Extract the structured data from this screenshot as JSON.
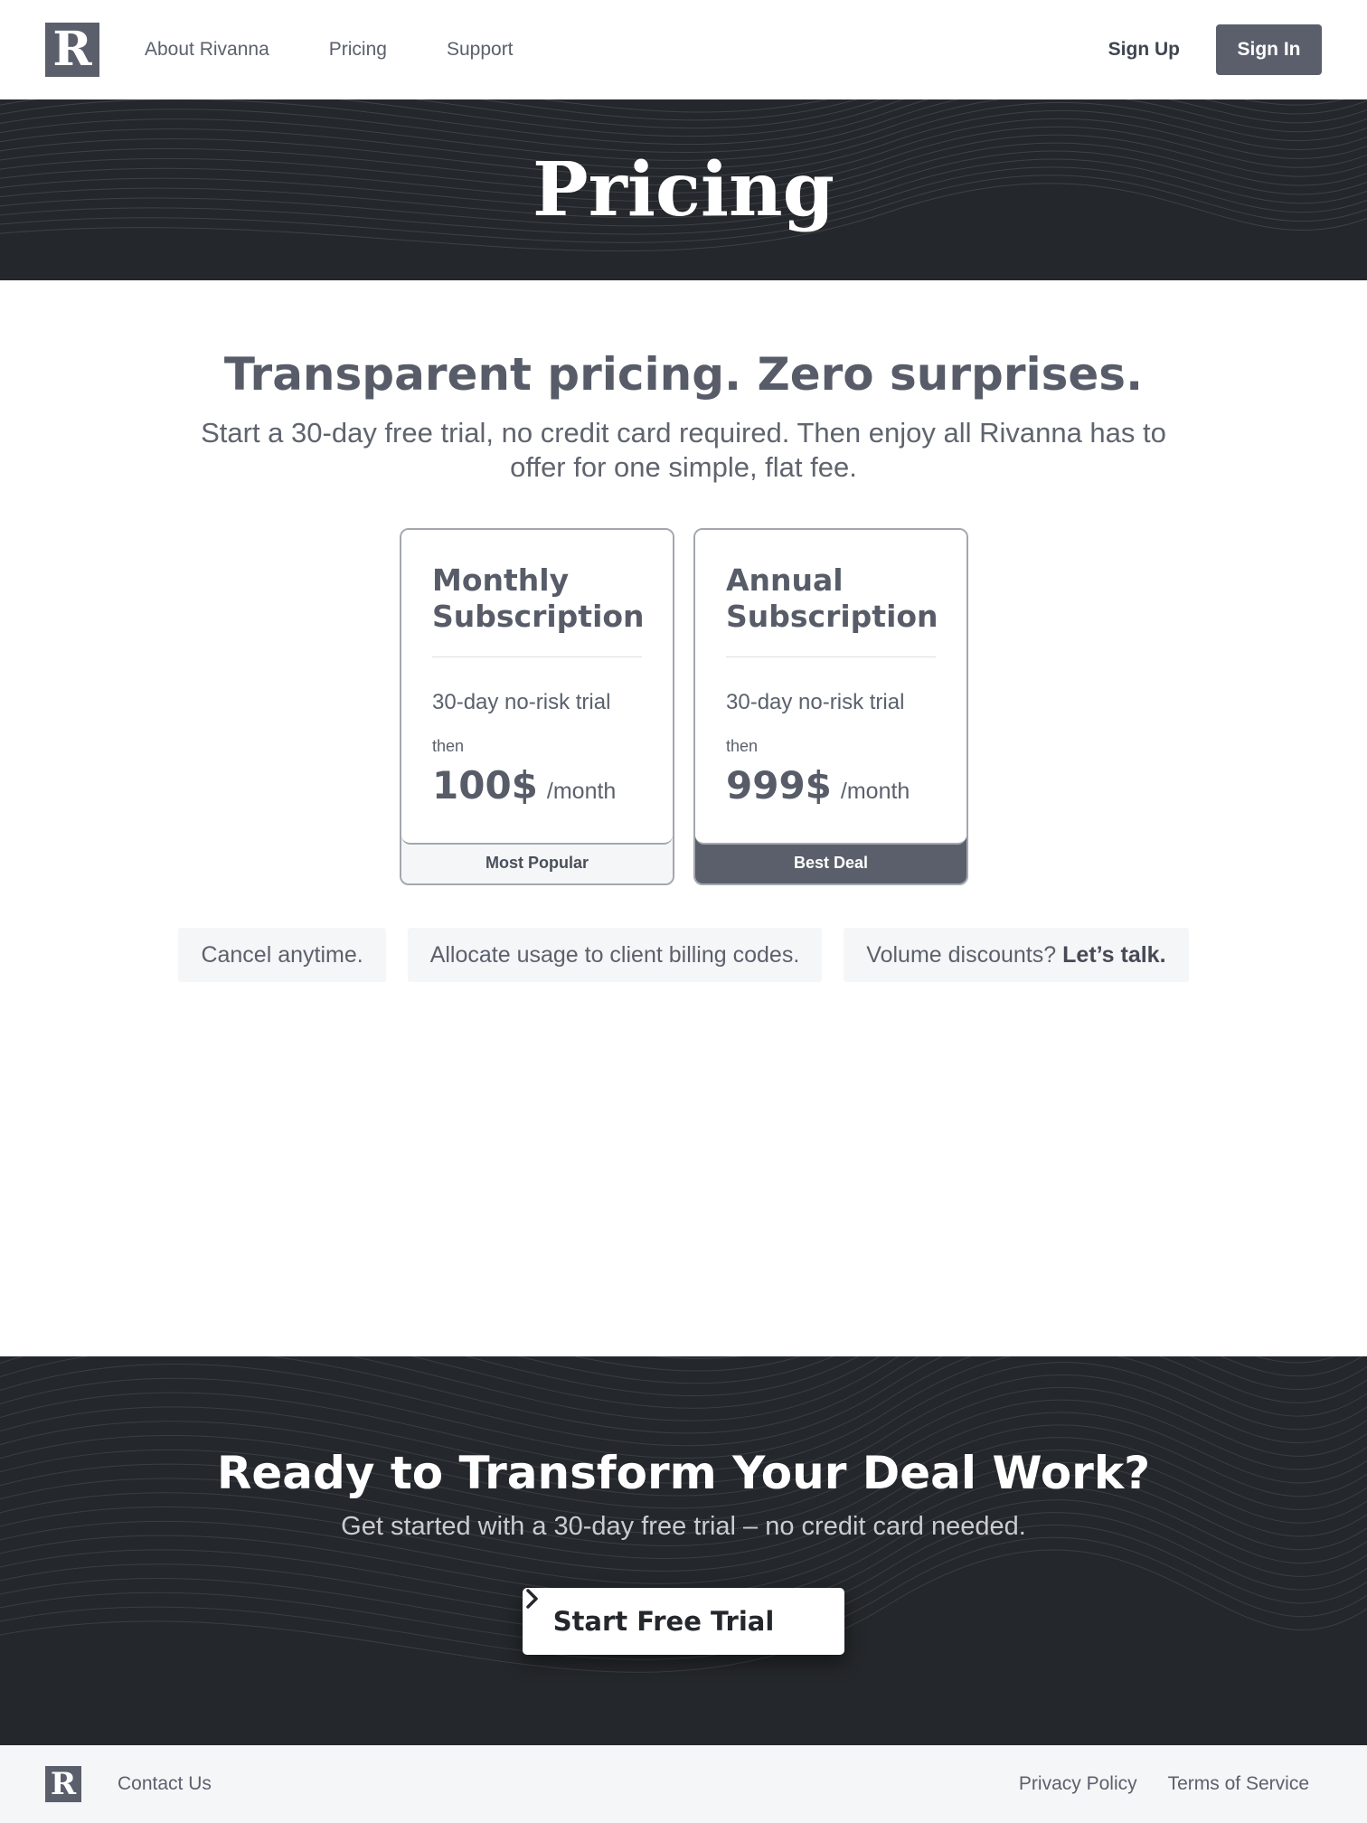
{
  "header": {
    "logo_letter": "R",
    "nav": [
      "About Rivanna",
      "Pricing",
      "Support"
    ],
    "sign_up": "Sign Up",
    "sign_in": "Sign In"
  },
  "hero": {
    "title": "Pricing"
  },
  "main": {
    "headline": "Transparent pricing. Zero surprises.",
    "subtext": "Start a 30-day free trial, no credit card required. Then enjoy all Rivanna has to offer for one simple, flat fee.",
    "plans": [
      {
        "title": "Monthly Subscription",
        "trial": "30-day no-risk trial",
        "then": "then",
        "price": "100$",
        "period": "/month",
        "badge": "Most Popular"
      },
      {
        "title": "Annual Subscription",
        "trial": "30-day no-risk trial",
        "then": "then",
        "price": "999$",
        "period": "/month",
        "badge": "Best Deal"
      }
    ],
    "chips": {
      "cancel": "Cancel anytime.",
      "allocate": "Allocate usage to client billing codes.",
      "volume": "Volume discounts?",
      "talk": "Let’s talk."
    }
  },
  "cta": {
    "title": "Ready to Transform Your Deal Work?",
    "subtitle": "Get started with a 30-day free trial – no credit card needed.",
    "button": "Start Free Trial"
  },
  "footer": {
    "logo_letter": "R",
    "contact": "Contact Us",
    "privacy": "Privacy Policy",
    "terms": "Terms of Service"
  },
  "colors": {
    "primary": "#5a5f6b",
    "dark_band": "#24272b",
    "light_bg": "#f5f6f8"
  }
}
